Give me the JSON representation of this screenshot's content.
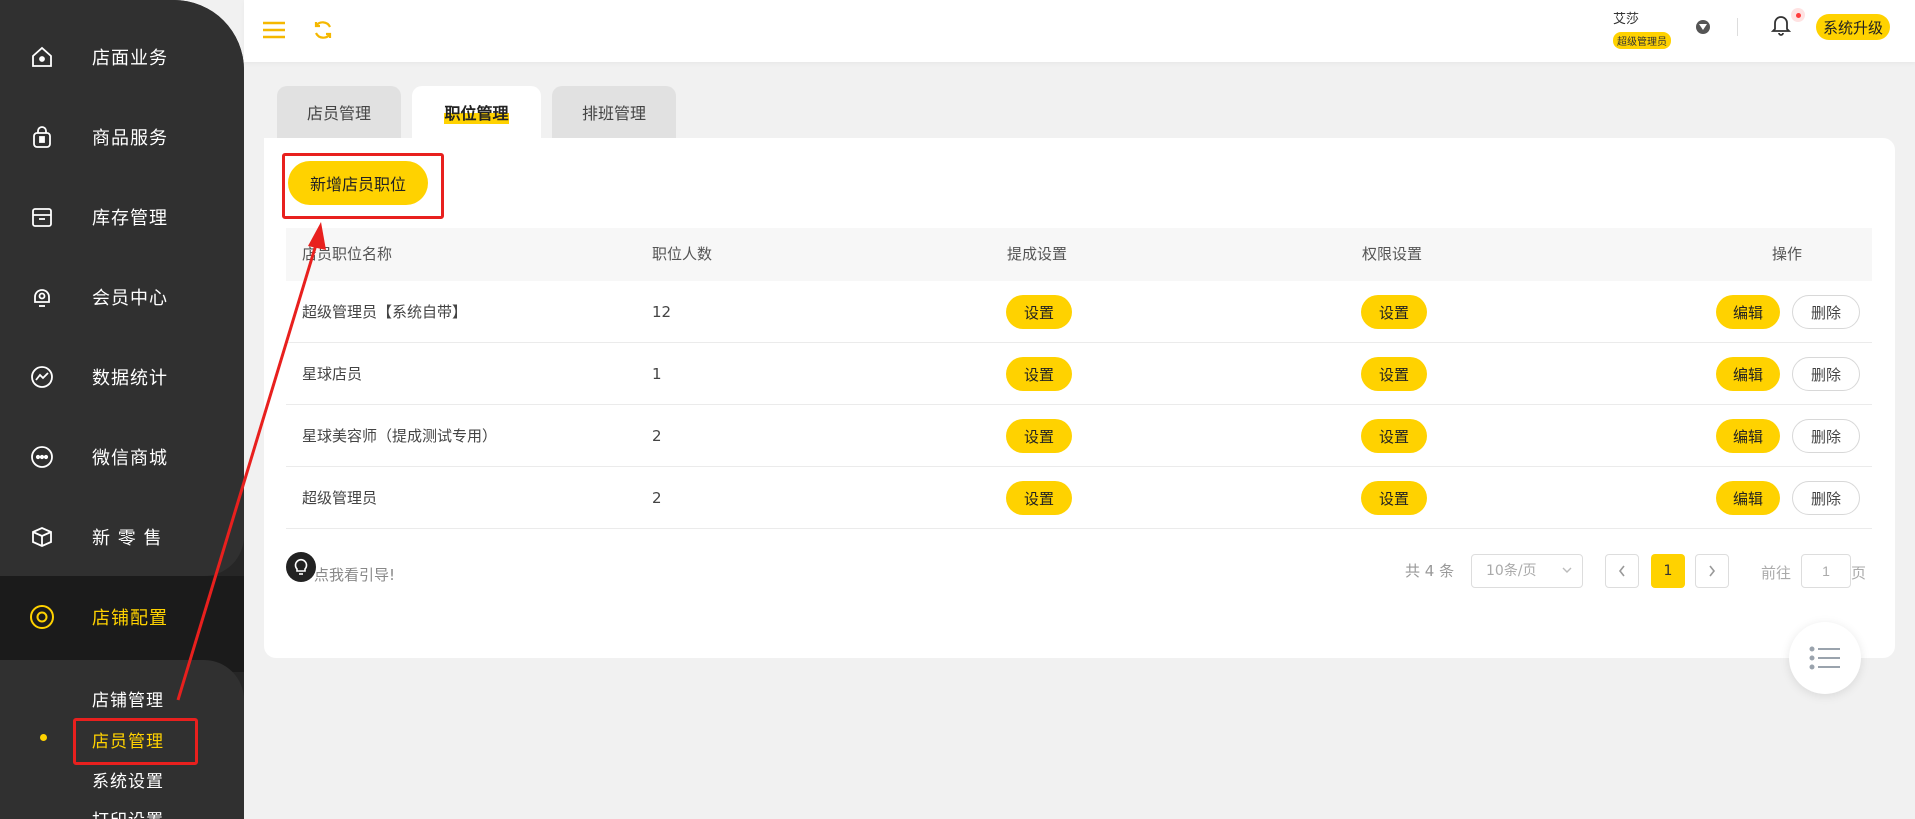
{
  "sidebar": {
    "items": [
      {
        "label": "店面业务",
        "icon": "home-icon"
      },
      {
        "label": "商品服务",
        "icon": "bag-icon"
      },
      {
        "label": "库存管理",
        "icon": "inventory-icon"
      },
      {
        "label": "会员中心",
        "icon": "member-icon"
      },
      {
        "label": "数据统计",
        "icon": "chart-icon"
      },
      {
        "label": "微信商城",
        "icon": "chat-icon"
      },
      {
        "label": "新 零 售",
        "icon": "box-icon"
      },
      {
        "label": "店铺配置",
        "icon": "settings-icon"
      }
    ],
    "sub_items": [
      "店铺管理",
      "店员管理",
      "系统设置",
      "打印设置"
    ]
  },
  "header": {
    "user_name": "艾莎",
    "user_role": "超级管理员",
    "upgrade_label": "系统升级"
  },
  "tabs": [
    "店员管理",
    "职位管理",
    "排班管理"
  ],
  "add_button": "新增店员职位",
  "table": {
    "headers": [
      "店员职位名称",
      "职位人数",
      "提成设置",
      "权限设置",
      "操作"
    ],
    "rows": [
      {
        "name": "超级管理员【系统自带】",
        "count": "12"
      },
      {
        "name": "星球店员",
        "count": "1"
      },
      {
        "name": "星球美容师（提成测试专用）",
        "count": "2"
      },
      {
        "name": "超级管理员",
        "count": "2"
      }
    ],
    "set_label": "设置",
    "edit_label": "编辑",
    "delete_label": "删除"
  },
  "footer": {
    "guide_text": "点我看引导!",
    "total": "共 4 条",
    "page_size": "10条/页",
    "current_page": "1",
    "goto_label": "前往",
    "goto_value": "1",
    "goto_suffix": "页"
  },
  "colors": {
    "accent": "#ffd200",
    "sidebar_bg": "#262626",
    "annotation_red": "#e8201e"
  }
}
